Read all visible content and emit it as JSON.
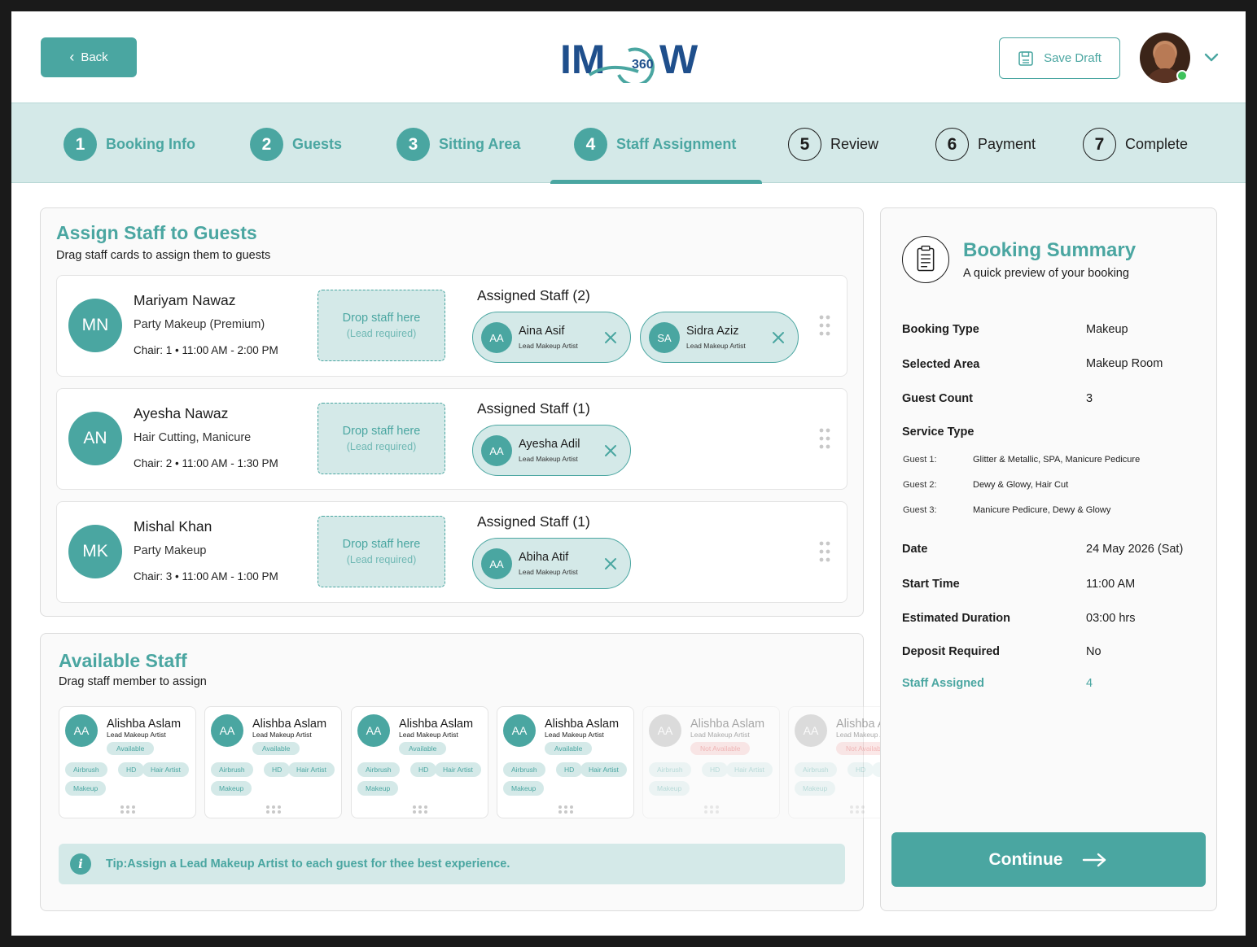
{
  "header": {
    "back_label": "Back",
    "logo_text": "IMW",
    "logo_badge": "360",
    "save_draft_label": "Save Draft"
  },
  "steps": [
    {
      "num": "1",
      "label": "Booking Info"
    },
    {
      "num": "2",
      "label": "Guests"
    },
    {
      "num": "3",
      "label": "Sitting Area"
    },
    {
      "num": "4",
      "label": "Staff Assignment"
    },
    {
      "num": "5",
      "label": "Review"
    },
    {
      "num": "6",
      "label": "Payment"
    },
    {
      "num": "7",
      "label": "Complete"
    }
  ],
  "assign": {
    "title": "Assign Staff to Guests",
    "subtitle": "Drag staff cards to assign them to guests",
    "drop_label": "Drop staff here",
    "drop_hint": "(Lead required)",
    "guests": [
      {
        "initials": "MN",
        "name": "Mariyam Nawaz",
        "service": "Party Makeup (Premium)",
        "chair": "Chair: 1  •  11:00 AM - 2:00 PM",
        "assigned_title": "Assigned Staff (2)",
        "staff": [
          {
            "initials": "AA",
            "name": "Aina Asif",
            "role": "Lead Makeup Artist"
          },
          {
            "initials": "SA",
            "name": "Sidra Aziz",
            "role": "Lead Makeup Artist"
          }
        ]
      },
      {
        "initials": "AN",
        "name": "Ayesha Nawaz",
        "service": "Hair Cutting, Manicure",
        "chair": "Chair: 2  •  11:00 AM - 1:30 PM",
        "assigned_title": "Assigned Staff (1)",
        "staff": [
          {
            "initials": "AA",
            "name": "Ayesha Adil",
            "role": "Lead Makeup Artist"
          }
        ]
      },
      {
        "initials": "MK",
        "name": "Mishal Khan",
        "service": "Party Makeup",
        "chair": "Chair: 3  •  11:00 AM - 1:00 PM",
        "assigned_title": "Assigned Staff (1)",
        "staff": [
          {
            "initials": "AA",
            "name": "Abiha Atif",
            "role": "Lead Makeup Artist"
          }
        ]
      }
    ]
  },
  "available": {
    "title": "Available Staff",
    "subtitle": "Drag staff member to assign",
    "tags": [
      "Airbrush",
      "HD",
      "Hair Artist",
      "Makeup"
    ],
    "staff": [
      {
        "initials": "AA",
        "name": "Alishba Aslam",
        "role": "Lead Makeup Artist",
        "status": "Available"
      },
      {
        "initials": "AA",
        "name": "Alishba Aslam",
        "role": "Lead Makeup Artist",
        "status": "Available"
      },
      {
        "initials": "AA",
        "name": "Alishba Aslam",
        "role": "Lead Makeup Artist",
        "status": "Available"
      },
      {
        "initials": "AA",
        "name": "Alishba Aslam",
        "role": "Lead Makeup Artist",
        "status": "Available"
      },
      {
        "initials": "AA",
        "name": "Alishba Aslam",
        "role": "Lead Makeup Artist",
        "status": "Not Available"
      },
      {
        "initials": "AA",
        "name": "Alishba Aslam",
        "role": "Lead Makeup Artist",
        "status": "Not Available"
      }
    ],
    "tip": "Tip:Assign a Lead Makeup Artist to each guest for thee best experience."
  },
  "summary": {
    "title": "Booking Summary",
    "subtitle": "A quick preview of your booking",
    "booking_type_label": "Booking Type",
    "booking_type": "Makeup",
    "area_label": "Selected Area",
    "area": "Makeup Room",
    "guest_count_label": "Guest Count",
    "guest_count": "3",
    "service_type_label": "Service Type",
    "guest_services": [
      {
        "label": "Guest 1:",
        "value": "Glitter & Metallic, SPA, Manicure Pedicure"
      },
      {
        "label": "Guest 2:",
        "value": "Dewy & Glowy, Hair Cut"
      },
      {
        "label": "Guest 3:",
        "value": "Manicure Pedicure, Dewy & Glowy"
      }
    ],
    "date_label": "Date",
    "date": "24 May 2026 (Sat)",
    "start_label": "Start Time",
    "start": "11:00 AM",
    "duration_label": "Estimated Duration",
    "duration": "03:00 hrs",
    "deposit_label": "Deposit Required",
    "deposit": "No",
    "staff_assigned_label": "Staff Assigned",
    "staff_assigned": "4",
    "continue_label": "Continue"
  },
  "colors": {
    "accent": "#4aa6a1",
    "accent_light": "#d4e9e8",
    "unavailable": "#f7c5c5"
  }
}
